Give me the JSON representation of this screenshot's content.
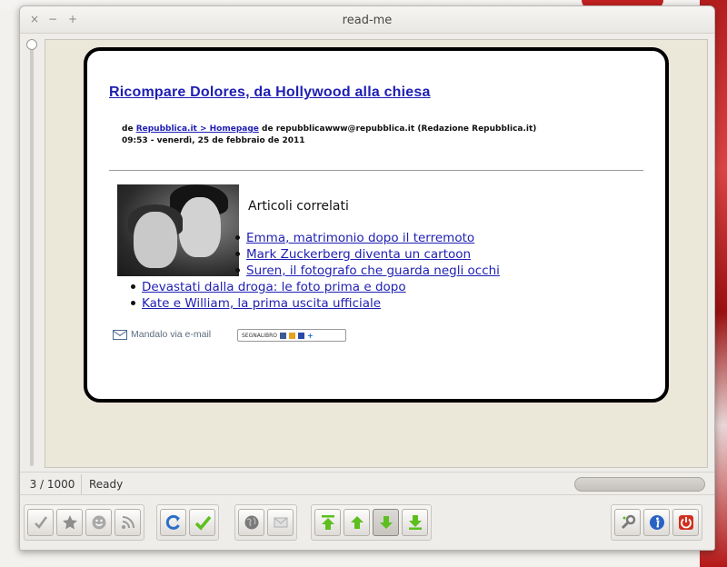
{
  "window": {
    "title": "read-me",
    "controls": {
      "close": "×",
      "minimize": "−",
      "maximize": "+"
    }
  },
  "article": {
    "headline": "Ricompare Dolores, da Hollywood alla chiesa",
    "meta_prefix": "de ",
    "meta_source": "Repubblica.it > Homepage",
    "meta_rest": " de repubblicawww@repubblica.it (Redazione Repubblica.it)",
    "meta_date": "09:53 - venerdì, 25 de febbraio de 2011",
    "related_title": "Articoli correlati",
    "related_links": [
      "Emma, matrimonio dopo il terremoto",
      "Mark Zuckerberg diventa un cartoon",
      "Suren, il fotografo che guarda negli occhi",
      "Devastati dalla droga: le foto prima e dopo",
      "Kate e William, la prima uscita ufficiale"
    ],
    "mail_label": "Mandalo via e-mail",
    "bookmark_label": "SEGNALIBRO"
  },
  "status": {
    "counter": "3 / 1000",
    "text": "Ready",
    "progress": 0
  },
  "toolbar": {
    "groups": [
      [
        "check-icon",
        "star-icon",
        "smiley-icon",
        "feed-icon"
      ],
      [
        "refresh-icon",
        "mark-read-icon"
      ],
      [
        "globe-icon",
        "mail-icon"
      ],
      [
        "first-icon",
        "previous-icon",
        "next-icon",
        "last-icon"
      ],
      [
        "settings-icon",
        "info-icon",
        "power-icon"
      ]
    ]
  },
  "colors": {
    "link": "#1e1eb4",
    "content_bg": "#ebe7d9",
    "arrow_green": "#5cbf1f"
  }
}
